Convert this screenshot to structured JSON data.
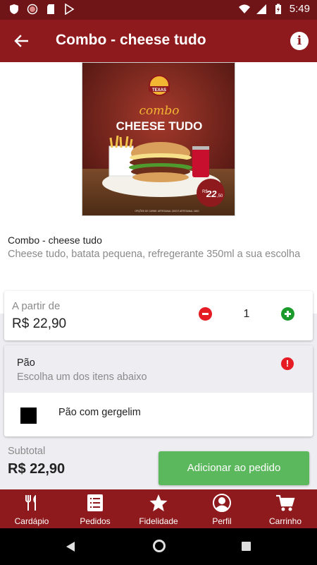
{
  "status_bar": {
    "time": "5:49"
  },
  "app_bar": {
    "title": "Combo - cheese tudo",
    "back_icon": "arrow-left-icon",
    "info_icon": "info-icon",
    "info_symbol": "i"
  },
  "hero_image": {
    "brand": "TEXAS",
    "headline_script": "combo",
    "headline": "CHEESE TUDO",
    "price_badge_currency": "R$",
    "price_badge_value": "22",
    "price_badge_cents": ",50",
    "footnote": "OPÇÕES DE CARNE: ARTESANAL 130G E ARTESANAL 160G"
  },
  "product": {
    "name": "Combo - cheese tudo",
    "description": "Cheese tudo, batata pequena, refregerante 350ml a sua escolha"
  },
  "price_card": {
    "label": "A partir de",
    "price": "R$ 22,90",
    "quantity": "1",
    "minus_icon": "minus-circle-icon",
    "plus_icon": "plus-circle-icon"
  },
  "option_group": {
    "title": "Pão",
    "subtitle": "Escolha um dos itens abaixo",
    "alert_icon": "alert-circle-icon",
    "alert_symbol": "!",
    "items": [
      {
        "label": "Pão com gergelim",
        "checked": false
      }
    ]
  },
  "footer": {
    "subtotal_label": "Subtotal",
    "subtotal_value": "R$ 22,90",
    "add_button_label": "Adicionar ao pedido"
  },
  "bottom_nav": {
    "items": [
      {
        "label": "Cardápio",
        "icon": "cutlery-icon"
      },
      {
        "label": "Pedidos",
        "icon": "list-icon"
      },
      {
        "label": "Fidelidade",
        "icon": "star-icon"
      },
      {
        "label": "Perfil",
        "icon": "user-circle-icon"
      },
      {
        "label": "Carrinho",
        "icon": "cart-icon"
      }
    ]
  },
  "colors": {
    "primary": "#8e1a1d",
    "status_bar": "#6f1517",
    "add_button": "#5cb85c",
    "minus": "#e51c23",
    "plus": "#1c9b2c"
  }
}
